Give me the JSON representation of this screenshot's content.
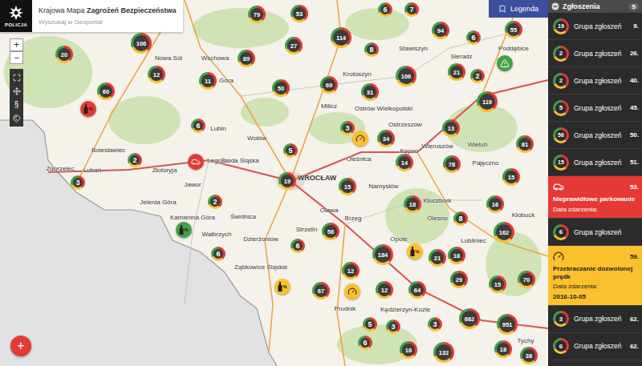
{
  "header": {
    "logo": "POLICJA",
    "title_regular": "Krajowa Mapa ",
    "title_bold": "Zagrożeń Bezpieczeństwa",
    "search_placeholder": "Wyszukaj w Geoportal"
  },
  "zoom": {
    "in": "+",
    "out": "−"
  },
  "tools": [
    {
      "kind": "fullscreen"
    },
    {
      "kind": "move"
    },
    {
      "kind": "paragraph",
      "symbol": "§"
    },
    {
      "kind": "tags"
    }
  ],
  "legend": {
    "label": "Legenda"
  },
  "fab": {
    "symbol": "+"
  },
  "map": {
    "labels": [
      {
        "text": "Nowa Sól",
        "kind": "town"
      },
      {
        "text": "Wschowa",
        "kind": "town"
      },
      {
        "text": "Góra",
        "kind": "town"
      },
      {
        "text": "Krotoszyn",
        "kind": "town"
      },
      {
        "text": "Ostrów Wielkopolski",
        "kind": "town"
      },
      {
        "text": "Milicz",
        "kind": "town"
      },
      {
        "text": "Sieradz",
        "kind": "town"
      },
      {
        "text": "Poddębice",
        "kind": "town"
      },
      {
        "text": "Stawiszyn",
        "kind": "town"
      },
      {
        "text": "Lubin",
        "kind": "town"
      },
      {
        "text": "Legnica",
        "kind": "town"
      },
      {
        "text": "Bolesławiec",
        "kind": "town"
      },
      {
        "text": "Zgorzelec",
        "kind": "town"
      },
      {
        "text": "Lubań",
        "kind": "town"
      },
      {
        "text": "Złotoryja",
        "kind": "town"
      },
      {
        "text": "Jawor",
        "kind": "town"
      },
      {
        "text": "Jelenia Góra",
        "kind": "town"
      },
      {
        "text": "Kamienna Góra",
        "kind": "town"
      },
      {
        "text": "Wałbrzych",
        "kind": "town"
      },
      {
        "text": "Świdnica",
        "kind": "town"
      },
      {
        "text": "Dzierżoniów",
        "kind": "town"
      },
      {
        "text": "Ząbkowice Śląskie",
        "kind": "town"
      },
      {
        "text": "Środa Śląska",
        "kind": "town"
      },
      {
        "text": "Wołów",
        "kind": "town"
      },
      {
        "text": "WROCŁAW",
        "kind": "city"
      },
      {
        "text": "Oleśnica",
        "kind": "town"
      },
      {
        "text": "Namysłów",
        "kind": "town"
      },
      {
        "text": "Kępno",
        "kind": "town"
      },
      {
        "text": "Wieruszów",
        "kind": "town"
      },
      {
        "text": "Ostrzeszów",
        "kind": "town"
      },
      {
        "text": "Oława",
        "kind": "town"
      },
      {
        "text": "Brzeg",
        "kind": "town"
      },
      {
        "text": "Strzelin",
        "kind": "town"
      },
      {
        "text": "Kluczbork",
        "kind": "town"
      },
      {
        "text": "Olesno",
        "kind": "town"
      },
      {
        "text": "Lubliniec",
        "kind": "town"
      },
      {
        "text": "Kłobuck",
        "kind": "town"
      },
      {
        "text": "Pajęczno",
        "kind": "town"
      },
      {
        "text": "Wieluń",
        "kind": "town"
      },
      {
        "text": "Opole",
        "kind": "town"
      },
      {
        "text": "Prudnik",
        "kind": "town"
      },
      {
        "text": "Kędzierzyn-Koźle",
        "kind": "town"
      },
      {
        "text": "Tychy",
        "kind": "town"
      }
    ],
    "clusters": [
      "79",
      "53",
      "6",
      "7",
      "106",
      "114",
      "94",
      "55",
      "6",
      "27",
      "8",
      "20",
      "12",
      "60",
      "89",
      "11",
      "50",
      "69",
      "106",
      "2",
      "31",
      "119",
      "21",
      "3",
      "6",
      "34",
      "13",
      "81",
      "5",
      "14",
      "78",
      "15",
      "19",
      "3",
      "2",
      "15",
      "18",
      "2",
      "16",
      "8",
      "56",
      "6",
      "162",
      "6",
      "184",
      "18",
      "21",
      "15",
      "70",
      "29",
      "12",
      "67",
      "12",
      "64",
      "662",
      "951",
      "5",
      "3",
      "3",
      "132",
      "16",
      "6",
      "18",
      "38"
    ],
    "markers": [
      {
        "kind": "alcohol",
        "color": "#e53935",
        "symbol": "%"
      },
      {
        "kind": "parking",
        "color": "#e53935"
      },
      {
        "kind": "alcohol",
        "color": "#43a047",
        "symbol": "%"
      },
      {
        "kind": "alcohol",
        "color": "#fbc02d",
        "symbol": "%"
      },
      {
        "kind": "alcohol",
        "color": "#fbc02d",
        "symbol": "%"
      },
      {
        "kind": "speed",
        "color": "#fbc02d"
      },
      {
        "kind": "speed",
        "color": "#fbc02d"
      },
      {
        "kind": "warning",
        "color": "#43a047"
      }
    ]
  },
  "sidebar": {
    "title": "Zgłoszenia",
    "badge": "5",
    "items": [
      {
        "kind": "group",
        "count": "19",
        "label": "Grupa zgłoszeń",
        "distance": "9."
      },
      {
        "kind": "group",
        "count": "2",
        "label": "Grupa zgłoszeń",
        "distance": "26."
      },
      {
        "kind": "group",
        "count": "2",
        "label": "Grupa zgłoszeń",
        "distance": "40."
      },
      {
        "kind": "group",
        "count": "5",
        "label": "Grupa zgłoszeń",
        "distance": "45."
      },
      {
        "kind": "group",
        "count": "56",
        "label": "Grupa zgłoszeń",
        "distance": "50."
      },
      {
        "kind": "group",
        "count": "15",
        "label": "Grupa zgłoszeń",
        "distance": "51."
      },
      {
        "kind": "parking",
        "color": "#e53935",
        "label": "Nieprawidłowe parkowanie",
        "date_label": "Data zdarzenia:",
        "distance": "53."
      },
      {
        "kind": "group",
        "count": "6",
        "label": "Grupa zgłoszeń"
      },
      {
        "kind": "speed",
        "color": "#fbc02d",
        "label": "Przekraczanie dozwolonej prędk",
        "date_label": "Data zdarzenia:",
        "date": "2016-10-05",
        "distance": "59."
      },
      {
        "kind": "group",
        "count": "3",
        "label": "Grupa zgłoszeń",
        "distance": "62."
      },
      {
        "kind": "group",
        "count": "6",
        "label": "Grupa zgłoszeń",
        "distance": "62."
      }
    ]
  }
}
